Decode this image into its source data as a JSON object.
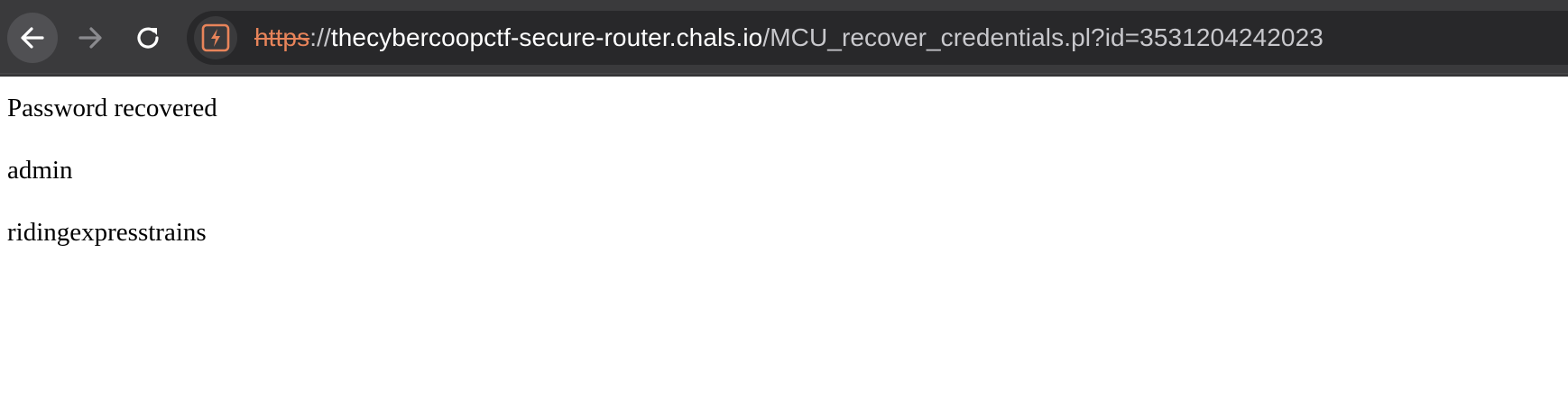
{
  "browser": {
    "url": {
      "scheme": "https",
      "separator": "://",
      "host": "thecybercoopctf-secure-router.chals.io",
      "path": "/MCU_recover_credentials.pl?id=3531204242023"
    },
    "colors": {
      "toolbar_bg": "#3a3a3c",
      "omnibox_bg": "#28282a",
      "insecure_accent": "#e8845a"
    },
    "icons": {
      "back": "back-arrow-icon",
      "forward": "forward-arrow-icon",
      "reload": "reload-icon",
      "site_info": "not-secure-icon"
    }
  },
  "page": {
    "lines": [
      "Password recovered",
      "admin",
      "ridingexpresstrains"
    ]
  }
}
